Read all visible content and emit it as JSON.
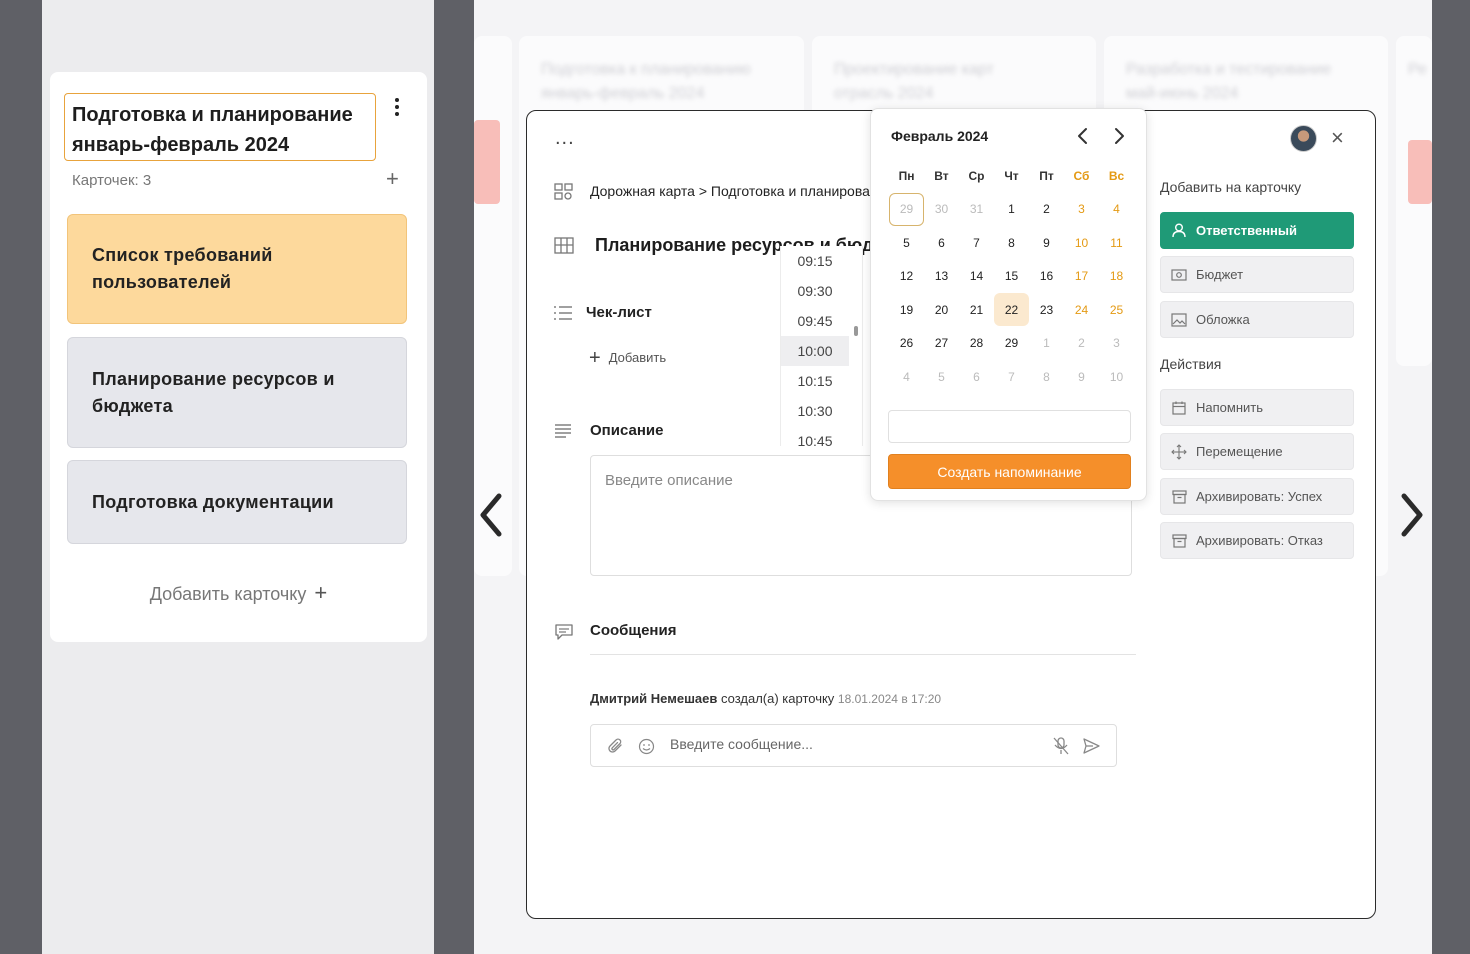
{
  "board_column": {
    "title": "Подготовка и планирование январь-февраль 2024",
    "card_count_label": "Карточек: 3",
    "add_icon": "plus-icon",
    "cards": [
      {
        "title": "Список требований пользователей"
      },
      {
        "title": "Планирование ресурсов и бюджета"
      },
      {
        "title": "Подготовка документации"
      }
    ],
    "add_card_label": "Добавить карточку",
    "add_card_icon": "+"
  },
  "background_columns": [
    {
      "title": "Подготовка к планированию январь-февраль 2024"
    },
    {
      "title": "Проектирование карт отрасль 2024"
    },
    {
      "title": "Разработка и тестирование май-июнь 2024"
    },
    {
      "title": "Ре…"
    }
  ],
  "modal": {
    "menu_label": "...",
    "breadcrumb": "Дорожная карта > Подготовка и планирование январь-февраль 2024",
    "card_title": "Планирование ресурсов и бюджета",
    "checklist_label": "Чек-лист",
    "checklist_add_label": "Добавить",
    "description_label": "Описание",
    "description_placeholder": "Введите описание",
    "messages_label": "Сообщения",
    "activity": {
      "author": "Дмитрий Немешаев",
      "action": "создал(а) карточку",
      "time": "18.01.2024 в 17:20"
    },
    "message_placeholder": "Введите сообщение...",
    "close_label": "×"
  },
  "sidebar": {
    "add_to_card_label": "Добавить на карточку",
    "add_buttons": [
      {
        "label": "Ответственный",
        "icon": "user-icon"
      },
      {
        "label": "Бюджет",
        "icon": "money-icon"
      },
      {
        "label": "Обложка",
        "icon": "image-icon"
      }
    ],
    "actions_label": "Действия",
    "action_buttons": [
      {
        "label": "Напомнить",
        "icon": "calendar-icon"
      },
      {
        "label": "Перемещение",
        "icon": "move-icon"
      },
      {
        "label": "Архивировать: Успех",
        "icon": "archive-icon"
      },
      {
        "label": "Архивировать: Отказ",
        "icon": "archive-icon"
      }
    ]
  },
  "time_picker": {
    "times": [
      "09:15",
      "09:30",
      "09:45",
      "10:00",
      "10:15",
      "10:30",
      "10:45"
    ],
    "selected": "10:00"
  },
  "calendar": {
    "month_label": "Февраль 2024",
    "weekdays": [
      "Пн",
      "Вт",
      "Ср",
      "Чт",
      "Пт",
      "Сб",
      "Вс"
    ],
    "weeks": [
      [
        "29",
        "30",
        "31",
        "1",
        "2",
        "3",
        "4"
      ],
      [
        "5",
        "6",
        "7",
        "8",
        "9",
        "10",
        "11"
      ],
      [
        "12",
        "13",
        "14",
        "15",
        "16",
        "17",
        "18"
      ],
      [
        "19",
        "20",
        "21",
        "22",
        "23",
        "24",
        "25"
      ],
      [
        "26",
        "27",
        "28",
        "29",
        "1",
        "2",
        "3"
      ],
      [
        "4",
        "5",
        "6",
        "7",
        "8",
        "9",
        "10"
      ]
    ],
    "today": "29 (January)",
    "selected_day": "22",
    "create_reminder_label": "Создать напоминание",
    "accent_color": "#e49a14",
    "button_color": "#f58a1f"
  },
  "colors": {
    "primary_button": "#1f9a77",
    "highlight_card": "#fdd99c",
    "column_title_border": "#e8a33c"
  }
}
